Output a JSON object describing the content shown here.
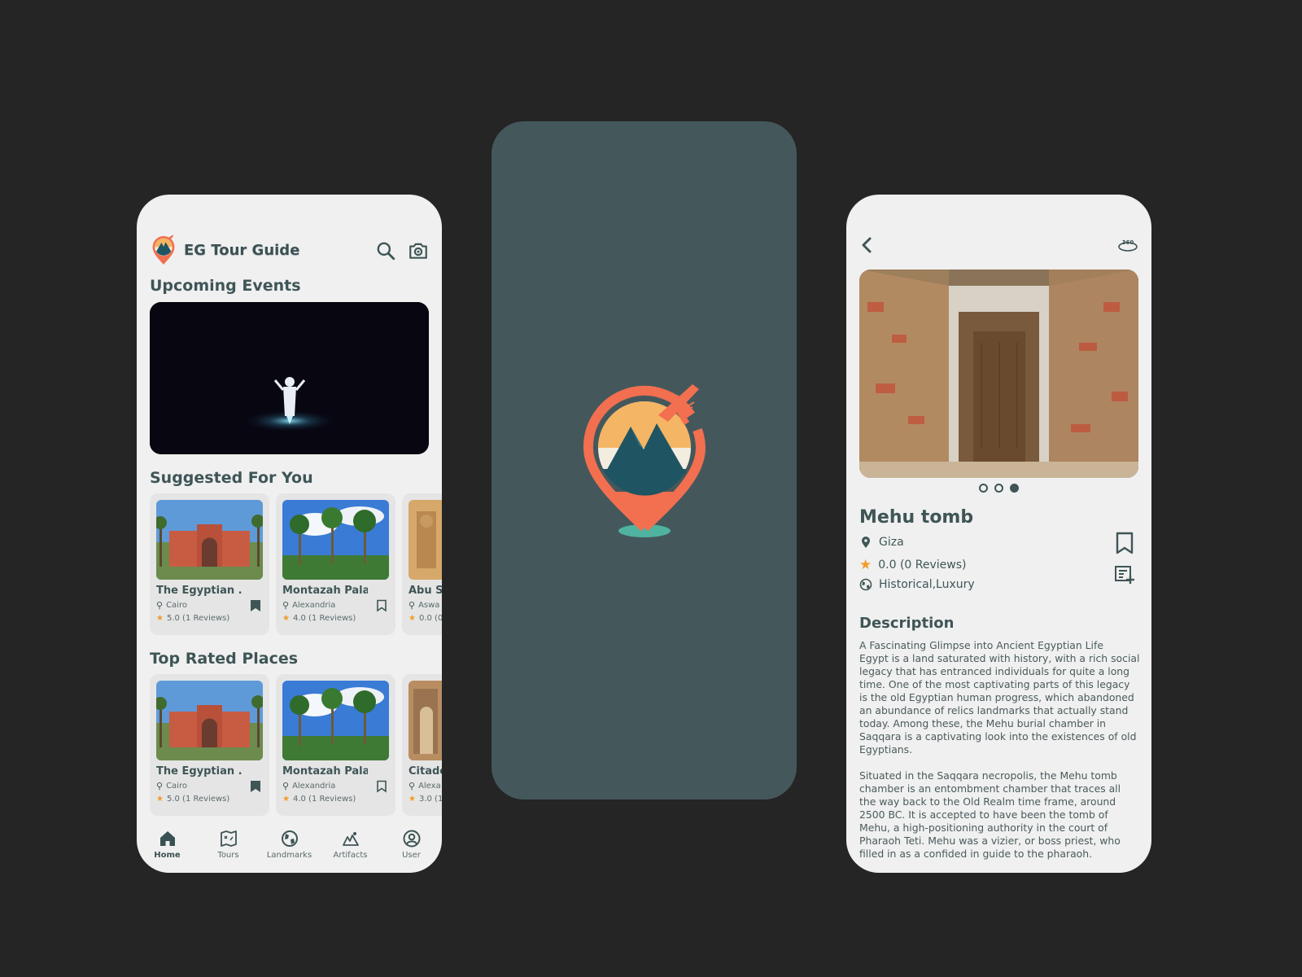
{
  "colors": {
    "accent": "#f26f4f",
    "primary_dark": "#3f5556",
    "splash_bg": "#44585c",
    "card_bg": "#e5e5e5",
    "star": "#f39a26"
  },
  "home": {
    "app_title": "EG Tour Guide",
    "icons": {
      "search": "search-icon",
      "camera": "camera-icon"
    },
    "sections": {
      "events": "Upcoming Events",
      "suggested": "Suggested For You",
      "top_rated": "Top Rated Places"
    },
    "suggested": [
      {
        "name": "The Egyptian ...",
        "location": "Cairo",
        "rating": "5.0 (1 Reviews)",
        "bookmarked": true
      },
      {
        "name": "Montazah Pala...",
        "location": "Alexandria",
        "rating": "4.0 (1 Reviews)",
        "bookmarked": false
      },
      {
        "name": "Abu S",
        "location": "Aswa",
        "rating": "0.0 (0",
        "bookmarked": false
      }
    ],
    "top_rated": [
      {
        "name": "The Egyptian ...",
        "location": "Cairo",
        "rating": "5.0 (1 Reviews)",
        "bookmarked": true
      },
      {
        "name": "Montazah Pala...",
        "location": "Alexandria",
        "rating": "4.0 (1 Reviews)",
        "bookmarked": false
      },
      {
        "name": "Citade",
        "location": "Alexa",
        "rating": "3.0 (1",
        "bookmarked": false
      }
    ],
    "nav": [
      {
        "label": "Home",
        "icon": "home-icon",
        "active": true
      },
      {
        "label": "Tours",
        "icon": "map-icon",
        "active": false
      },
      {
        "label": "Landmarks",
        "icon": "globe-icon",
        "active": false
      },
      {
        "label": "Artifacts",
        "icon": "artifact-icon",
        "active": false
      },
      {
        "label": "User",
        "icon": "user-icon",
        "active": false
      }
    ]
  },
  "detail": {
    "vr_label": "360",
    "title": "Mehu tomb",
    "location": "Giza",
    "rating": "0.0 (0 Reviews)",
    "categories": "Historical,Luxury",
    "description_title": "Description",
    "description": "A Fascinating Glimpse into Ancient Egyptian Life\nEgypt is a land saturated with history, with a rich social legacy that has entranced individuals for quite a long time. One of the most captivating parts of this legacy is the old Egyptian human progress, which abandoned an abundance of relics landmarks that actually stand today. Among these, the Mehu burial chamber in Saqqara is a captivating look into the existences of old Egyptians.\n\nSituated in the Saqqara necropolis, the Mehu tomb chamber is an entombment chamber that traces all the way back to the Old Realm time frame, around 2500 BC. It is accepted to have been the tomb  of Mehu, a high-positioning authority in the court of Pharaoh Teti. Mehu was a vizier, or boss priest, who filled in as a confided in guide to the pharaoh.",
    "carousel_active": 2
  }
}
